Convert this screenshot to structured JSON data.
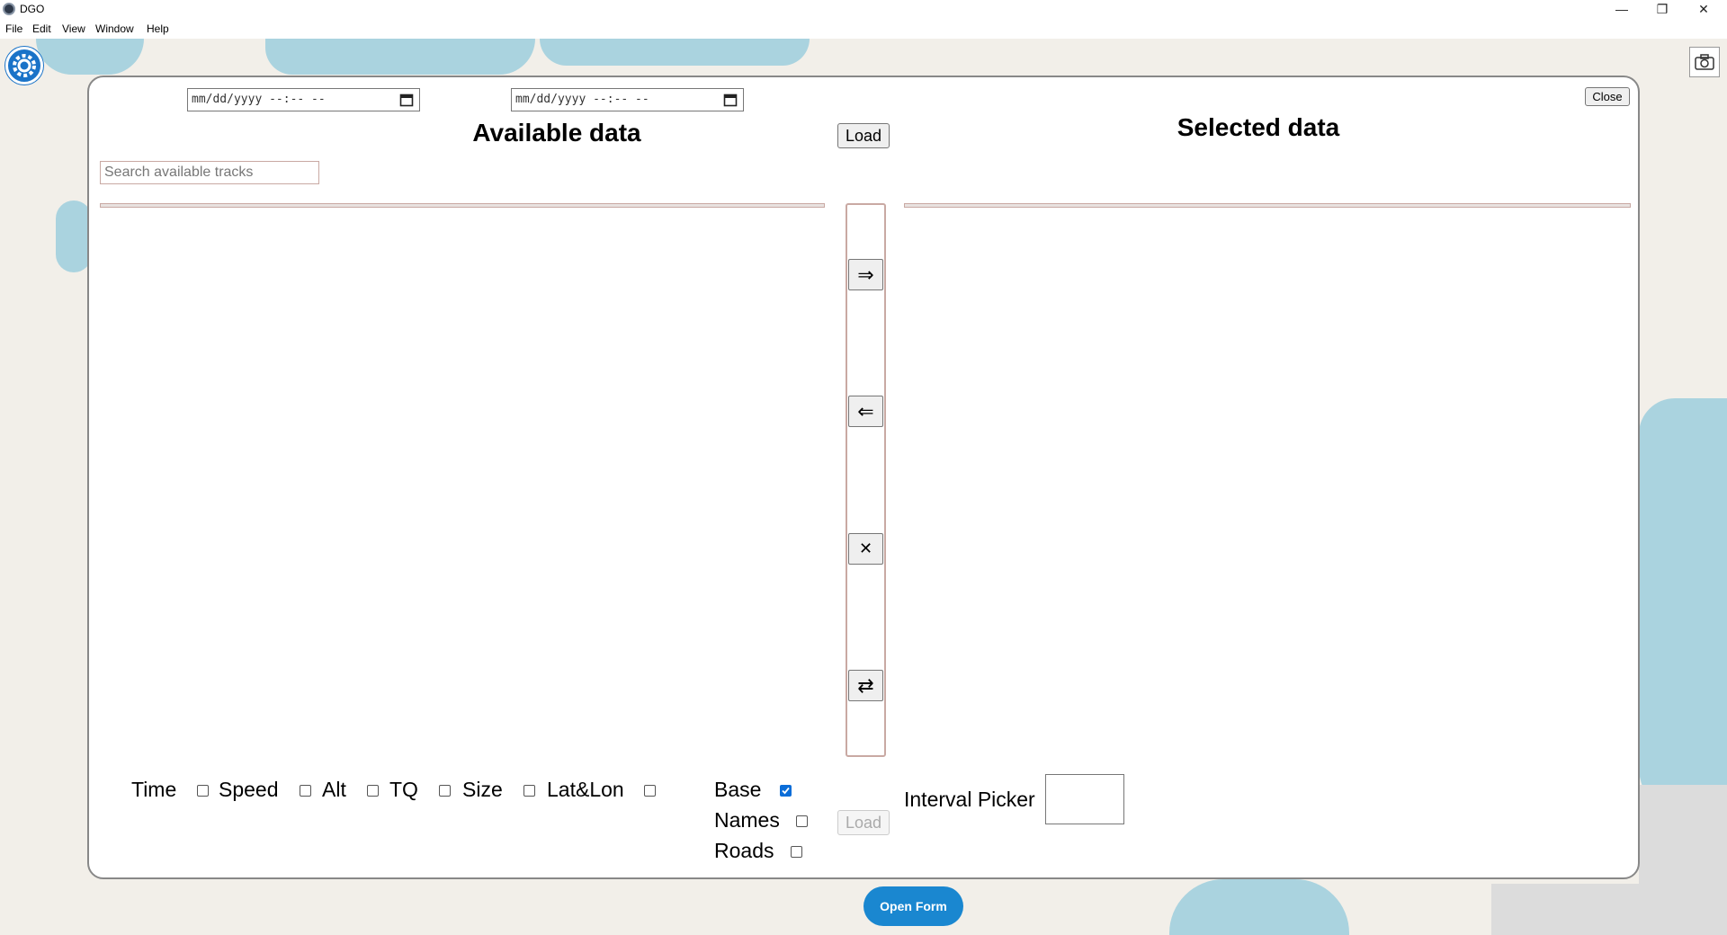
{
  "window": {
    "title": "DGO",
    "controls": {
      "minimize": "—",
      "restore": "❐",
      "close": "✕"
    }
  },
  "menu": [
    "File",
    "Edit",
    "View",
    "Window",
    "Help"
  ],
  "map": {
    "land_color": "#f2efe9",
    "water_color": "#aad3df"
  },
  "panel": {
    "date_from": "mm/dd/yyyy --:-- --",
    "date_to": "mm/dd/yyyy --:-- --",
    "available_heading": "Available data",
    "selected_heading": "Selected data",
    "load_label": "Load",
    "close_label": "Close",
    "search_placeholder": "Search available tracks",
    "transfer_buttons": [
      "⇒",
      "⇐",
      "✕",
      "⇄"
    ],
    "fields": [
      {
        "label": "Time",
        "checked": false
      },
      {
        "label": "Speed",
        "checked": false
      },
      {
        "label": "Alt",
        "checked": false
      },
      {
        "label": "TQ",
        "checked": false
      },
      {
        "label": "Size",
        "checked": false
      },
      {
        "label": "Lat&Lon",
        "checked": false
      }
    ],
    "layers": [
      {
        "label": "Base",
        "checked": true
      },
      {
        "label": "Names",
        "checked": false
      },
      {
        "label": "Roads",
        "checked": false
      }
    ],
    "layers_load_label": "Load",
    "interval_label": "Interval Picker",
    "interval_value": ""
  },
  "open_form_label": "Open Form",
  "icons": [
    "app-icon",
    "gear-icon",
    "camera-icon",
    "calendar-icon"
  ]
}
